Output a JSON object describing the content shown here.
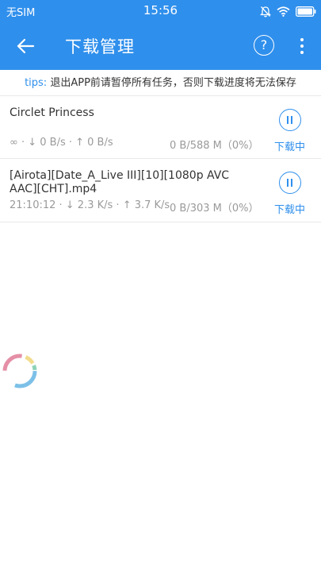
{
  "status_bar": {
    "carrier": "无SIM",
    "time": "15:56",
    "icons": [
      "alarm-off-icon",
      "wifi-icon",
      "battery-icon"
    ]
  },
  "app_bar": {
    "title": "下载管理",
    "back_icon": "arrow-left-icon",
    "help_label": "?",
    "more_icon": "more-vertical-icon"
  },
  "tips": {
    "label": "tips:",
    "text": " 退出APP前请暂停所有任务，否则下载进度将无法保存"
  },
  "tasks": [
    {
      "name": "Circlet Princess",
      "stats": "∞ · ↓ 0 B/s · ↑ 0 B/s",
      "size": "0 B/588 M（0%）",
      "status": "下载中",
      "action_icon": "pause-icon"
    },
    {
      "name": "[Airota][Date_A_Live III][10][1080p AVC AAC][CHT].mp4",
      "stats": "21:10:12 · ↓ 2.3 K/s · ↑ 3.7 K/s",
      "size": "0 B/303 M（0%）",
      "status": "下载中",
      "action_icon": "pause-icon"
    }
  ],
  "colors": {
    "primary": "#2f8fec",
    "text": "#333333",
    "secondary_text": "#9a9a9a",
    "divider": "#e8e8e8",
    "spinner_pink": "#e58fa6",
    "spinner_blue": "#7cc0e8",
    "spinner_yellow": "#f2dc8c",
    "spinner_green": "#8ed3b8"
  }
}
